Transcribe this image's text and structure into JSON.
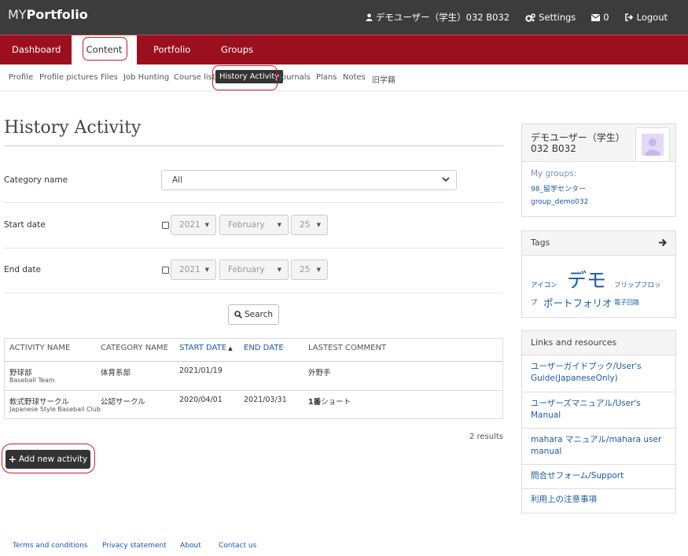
{
  "brand": {
    "my": "MY",
    "portfolio": "Portfolio"
  },
  "topnav": {
    "user": "デモユーザー（学生）032 B032",
    "settings": "Settings",
    "inbox_count": "0",
    "logout": "Logout"
  },
  "mainnav": [
    "Dashboard",
    "Content",
    "Portfolio",
    "Groups"
  ],
  "subnav": [
    "Profile",
    "Profile pictures",
    "Files",
    "Job Hunting",
    "Course list",
    "History Activity",
    "Journals",
    "Plans",
    "Notes",
    "旧学籍"
  ],
  "page": {
    "title": "History Activity"
  },
  "form": {
    "category_label": "Category name",
    "category_value": "All",
    "start_label": "Start date",
    "end_label": "End date",
    "start": {
      "year": "2021",
      "month": "February",
      "day": "25"
    },
    "end": {
      "year": "2021",
      "month": "February",
      "day": "25"
    },
    "search_label": "Search"
  },
  "table": {
    "headers": [
      "ACTIVITY NAME",
      "CATEGORY NAME",
      "START DATE",
      "END DATE",
      "LASTEST COMMENT"
    ],
    "rows": [
      {
        "name": "野球部",
        "name_sub": "Baseball Team",
        "category": "体育系部",
        "start": "2021/01/19",
        "end": "",
        "comment": "外野手",
        "comment_bold": ""
      },
      {
        "name": "軟式野球サークル",
        "name_sub": "Japanese Style Baseball Club",
        "category": "公認サークル",
        "start": "2020/04/01",
        "end": "2021/03/31",
        "comment": "ショート",
        "comment_bold": "1番"
      }
    ]
  },
  "results": "2 results",
  "add_button": "Add new activity",
  "footer": [
    "Terms and conditions",
    "Privacy statement",
    "About",
    "Contact us"
  ],
  "sidebar": {
    "user_name": "デモユーザー（学生）",
    "user_id": "032 B032",
    "groups_title": "My groups:",
    "groups": [
      "98_留学センター",
      "group_demo032"
    ],
    "tags_title": "Tags",
    "tags": [
      "アイコン",
      "デモ",
      "フリップフロッ",
      "プ",
      "ポートフォリオ",
      "電子回路"
    ],
    "links_title": "Links and resources",
    "links": [
      [
        "ユーザーガイドブック/User's",
        "Guide(JapaneseOnly)"
      ],
      [
        "ユーザーズマニュアル/User's",
        "Manual"
      ],
      [
        "mahara マニュアル/mahara user",
        "manual"
      ],
      [
        "問合せフォーム/Support"
      ],
      [
        "利用上の注意事項"
      ]
    ]
  },
  "colors": {
    "accent": "#9c0f1e",
    "topbar": "#3c3c3c",
    "link": "#1a5aa6",
    "highlight": "#c0202e"
  }
}
